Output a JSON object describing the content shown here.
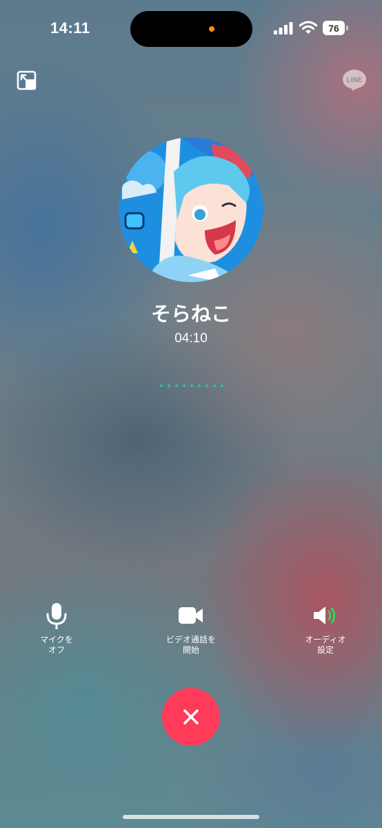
{
  "status_bar": {
    "time": "14:11",
    "battery_level": "76",
    "recording_indicator_color": "#ff8c1a"
  },
  "top_controls": {
    "minimize_icon": "picture-in-picture-icon",
    "app_badge": "LINE"
  },
  "call": {
    "contact_name": "そらねこ",
    "duration": "04:10",
    "voice_activity_dot_color": "#27c39b"
  },
  "controls": {
    "mic": {
      "icon": "microphone-icon",
      "label": "マイクを\nオフ"
    },
    "video": {
      "icon": "video-camera-icon",
      "label": "ビデオ通話を\n開始"
    },
    "audio": {
      "icon": "speaker-icon",
      "label": "オーディオ\n設定",
      "accent_color": "#2ee05a"
    }
  },
  "end_call": {
    "icon": "close-icon",
    "color": "#ff3b5a"
  }
}
